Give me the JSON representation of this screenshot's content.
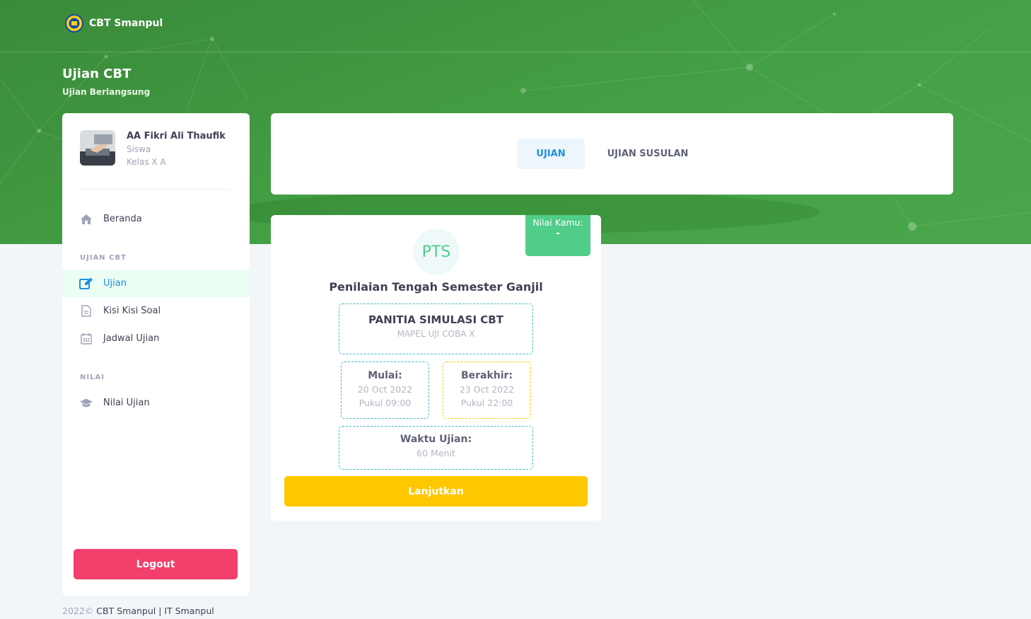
{
  "header": {
    "brand_name": "CBT Smanpul",
    "page_title": "Ujian CBT",
    "breadcrumb": "Ujian  Berlangsung"
  },
  "user": {
    "name": "AA Fikri Ali Thaufik",
    "role": "Siswa",
    "class": "Kelas X A"
  },
  "sidebar": {
    "home_label": "Beranda",
    "section_exam": "UJIAN CBT",
    "items_exam": [
      {
        "label": "Ujian",
        "icon": "edit-icon",
        "active": true
      },
      {
        "label": "Kisi Kisi Soal",
        "icon": "document-icon"
      },
      {
        "label": "Jadwal Ujian",
        "icon": "calendar-icon"
      }
    ],
    "section_score": "NILAI",
    "items_score": [
      {
        "label": "Nilai Ujian",
        "icon": "graduation-cap-icon"
      }
    ],
    "logout_label": "Logout"
  },
  "tabs": {
    "exam": "UJIAN",
    "makeup": "UJIAN SUSULAN"
  },
  "exam_card": {
    "score_label": "Nilai Kamu:",
    "score_value": "-",
    "code": "PTS",
    "title": "Penilaian Tengah Semester Ganjil",
    "committee": "PANITIA SIMULASI CBT",
    "subject": "MAPEL UJI COBA X",
    "start_label": "Mulai:",
    "start_date": "20 Oct 2022",
    "start_time": "Pukul 09:00",
    "end_label": "Berakhir:",
    "end_date": "23 Oct 2022",
    "end_time": "Pukul 22:00",
    "duration_label": "Waktu Ujian:",
    "duration_value": "60 Menit",
    "continue_label": "Lanjutkan"
  },
  "footer": {
    "year": "2022©",
    "text": "CBT Smanpul | IT Smanpul"
  },
  "colors": {
    "hero_green": "#44a044",
    "active_blue": "#1e8fe0",
    "logout_red": "#f33f6b",
    "continue_yellow": "#ffc700",
    "score_green": "#50cd89"
  }
}
